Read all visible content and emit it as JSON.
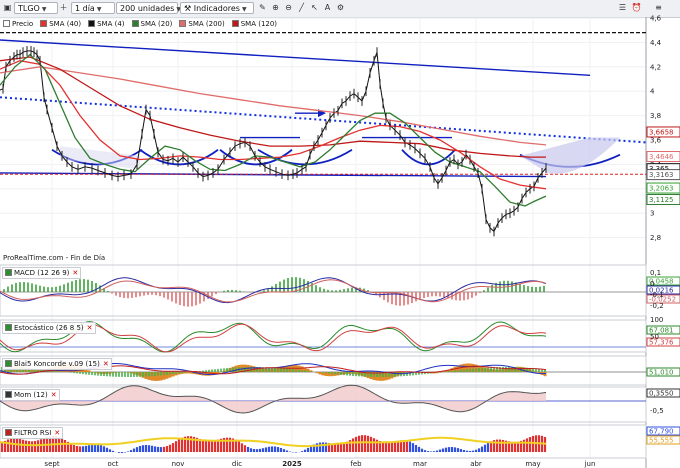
{
  "toolbar": {
    "symbol": "TLGO",
    "timeframe": "1 día",
    "units": "200 unidades",
    "indicators": "Indicadores"
  },
  "legend": [
    {
      "label": "Precio",
      "color": "#ffffff"
    },
    {
      "label": "SMA (40)",
      "color": "#e53030"
    },
    {
      "label": "SMA (4)",
      "color": "#111111"
    },
    {
      "label": "SMA (20)",
      "color": "#2f7d2f"
    },
    {
      "label": "SMA (200)",
      "color": "#e06c6c"
    },
    {
      "label": "SMA (120)",
      "color": "#c01818"
    }
  ],
  "credit": "ProRealTime.com - Fin de Día",
  "panels": {
    "macd": "MACD (12 26 9)",
    "stoch": "Estocástico (26 8 5)",
    "blai": "Blai5 Koncorde v.09 (15)",
    "mom": "Mom (12)",
    "rsi": "FILTRO RSI"
  },
  "months": [
    "sept",
    "oct",
    "nov",
    "dic",
    "2025",
    "feb",
    "mar",
    "abr",
    "may",
    "jun"
  ],
  "chart_data": {
    "type": "line",
    "title": "",
    "ylim": [
      2.6,
      4.6
    ],
    "yticks": [
      "4,6",
      "4,4",
      "4,2",
      "4",
      "3,8",
      "3,6",
      "3,4",
      "3,2",
      "3",
      "2,8"
    ],
    "price_tags": [
      {
        "value": 3.6658,
        "text": "3,6658",
        "color": "#c01818"
      },
      {
        "value": 3.4646,
        "text": "3,4646",
        "color": "#e06c6c"
      },
      {
        "value": 3.365,
        "text": "3,365",
        "color": "#111111"
      },
      {
        "value": 3.3163,
        "text": "3,3163",
        "color": "#555555"
      },
      {
        "value": 3.2063,
        "text": "3,2063",
        "color": "#2fa02f"
      },
      {
        "value": 3.1125,
        "text": "3,1125",
        "color": "#2f7d2f"
      }
    ],
    "series": [
      {
        "name": "Precio",
        "color": "#111111",
        "values": [
          [
            0,
            4.01
          ],
          [
            3,
            4.02
          ],
          [
            6,
            4.2
          ],
          [
            10,
            4.25
          ],
          [
            14,
            4.28
          ],
          [
            17,
            4.3
          ],
          [
            20,
            4.3
          ],
          [
            23,
            4.32
          ],
          [
            27,
            4.33
          ],
          [
            31,
            4.33
          ],
          [
            34,
            4.32
          ],
          [
            37,
            4.3
          ],
          [
            40,
            4.25
          ],
          [
            44,
            3.95
          ],
          [
            47,
            3.85
          ],
          [
            52,
            3.7
          ],
          [
            57,
            3.55
          ],
          [
            62,
            3.47
          ],
          [
            67,
            3.42
          ],
          [
            72,
            3.38
          ],
          [
            78,
            3.36
          ],
          [
            85,
            3.38
          ],
          [
            92,
            3.37
          ],
          [
            98,
            3.35
          ],
          [
            105,
            3.33
          ],
          [
            112,
            3.31
          ],
          [
            118,
            3.3
          ],
          [
            124,
            3.31
          ],
          [
            131,
            3.32
          ],
          [
            137,
            3.4
          ],
          [
            142,
            3.65
          ],
          [
            146,
            3.85
          ],
          [
            150,
            3.8
          ],
          [
            154,
            3.65
          ],
          [
            158,
            3.5
          ],
          [
            163,
            3.44
          ],
          [
            168,
            3.43
          ],
          [
            173,
            3.45
          ],
          [
            178,
            3.42
          ],
          [
            183,
            3.46
          ],
          [
            188,
            3.42
          ],
          [
            193,
            3.38
          ],
          [
            198,
            3.33
          ],
          [
            203,
            3.3
          ],
          [
            208,
            3.31
          ],
          [
            213,
            3.33
          ],
          [
            218,
            3.36
          ],
          [
            224,
            3.44
          ],
          [
            230,
            3.5
          ],
          [
            235,
            3.55
          ],
          [
            240,
            3.57
          ],
          [
            245,
            3.58
          ],
          [
            250,
            3.55
          ],
          [
            255,
            3.47
          ],
          [
            260,
            3.42
          ],
          [
            265,
            3.38
          ],
          [
            270,
            3.36
          ],
          [
            276,
            3.34
          ],
          [
            282,
            3.32
          ],
          [
            288,
            3.31
          ],
          [
            293,
            3.32
          ],
          [
            297,
            3.33
          ],
          [
            302,
            3.36
          ],
          [
            306,
            3.38
          ],
          [
            310,
            3.48
          ],
          [
            314,
            3.55
          ],
          [
            318,
            3.6
          ],
          [
            322,
            3.66
          ],
          [
            326,
            3.72
          ],
          [
            330,
            3.78
          ],
          [
            334,
            3.82
          ],
          [
            338,
            3.84
          ],
          [
            342,
            3.9
          ],
          [
            346,
            3.92
          ],
          [
            350,
            3.96
          ],
          [
            354,
            3.98
          ],
          [
            358,
            3.95
          ],
          [
            362,
            3.92
          ],
          [
            366,
            4.0
          ],
          [
            370,
            4.15
          ],
          [
            374,
            4.25
          ],
          [
            377,
            4.32
          ],
          [
            380,
            4.06
          ],
          [
            383,
            3.9
          ],
          [
            386,
            3.78
          ],
          [
            390,
            3.72
          ],
          [
            395,
            3.68
          ],
          [
            400,
            3.64
          ],
          [
            405,
            3.58
          ],
          [
            410,
            3.56
          ],
          [
            415,
            3.53
          ],
          [
            420,
            3.49
          ],
          [
            425,
            3.45
          ],
          [
            430,
            3.38
          ],
          [
            434,
            3.29
          ],
          [
            438,
            3.24
          ],
          [
            442,
            3.29
          ],
          [
            446,
            3.35
          ],
          [
            450,
            3.42
          ],
          [
            454,
            3.44
          ],
          [
            458,
            3.4
          ],
          [
            462,
            3.42
          ],
          [
            466,
            3.48
          ],
          [
            470,
            3.44
          ],
          [
            474,
            3.38
          ],
          [
            478,
            3.33
          ],
          [
            482,
            3.2
          ],
          [
            486,
            2.95
          ],
          [
            490,
            2.88
          ],
          [
            494,
            2.85
          ],
          [
            498,
            2.92
          ],
          [
            502,
            2.96
          ],
          [
            506,
            2.99
          ],
          [
            510,
            3.0
          ],
          [
            514,
            3.02
          ],
          [
            518,
            3.05
          ],
          [
            522,
            3.12
          ],
          [
            526,
            3.17
          ],
          [
            530,
            3.2
          ],
          [
            534,
            3.22
          ],
          [
            538,
            3.29
          ],
          [
            542,
            3.33
          ],
          [
            546,
            3.37
          ]
        ]
      },
      {
        "name": "SMA (200)",
        "color": "#e06c6c",
        "values": [
          [
            0,
            4.15
          ],
          [
            40,
            4.2
          ],
          [
            80,
            4.15
          ],
          [
            120,
            4.1
          ],
          [
            160,
            4.04
          ],
          [
            200,
            3.98
          ],
          [
            240,
            3.93
          ],
          [
            280,
            3.88
          ],
          [
            320,
            3.84
          ],
          [
            360,
            3.8
          ],
          [
            400,
            3.75
          ],
          [
            440,
            3.69
          ],
          [
            480,
            3.63
          ],
          [
            520,
            3.58
          ],
          [
            546,
            3.56
          ]
        ]
      },
      {
        "name": "SMA (120)",
        "color": "#c01818",
        "values": [
          [
            0,
            4.25
          ],
          [
            30,
            4.28
          ],
          [
            60,
            4.18
          ],
          [
            90,
            4.03
          ],
          [
            120,
            3.88
          ],
          [
            150,
            3.77
          ],
          [
            180,
            3.7
          ],
          [
            210,
            3.64
          ],
          [
            240,
            3.59
          ],
          [
            270,
            3.55
          ],
          [
            300,
            3.55
          ],
          [
            330,
            3.56
          ],
          [
            360,
            3.59
          ],
          [
            390,
            3.58
          ],
          [
            420,
            3.57
          ],
          [
            450,
            3.52
          ],
          [
            480,
            3.49
          ],
          [
            510,
            3.47
          ],
          [
            530,
            3.46
          ],
          [
            546,
            3.46
          ]
        ]
      },
      {
        "name": "SMA (40)",
        "color": "#e53030",
        "values": [
          [
            0,
            4.18
          ],
          [
            20,
            4.25
          ],
          [
            40,
            4.22
          ],
          [
            60,
            4.05
          ],
          [
            80,
            3.8
          ],
          [
            100,
            3.6
          ],
          [
            120,
            3.47
          ],
          [
            140,
            3.44
          ],
          [
            160,
            3.45
          ],
          [
            180,
            3.47
          ],
          [
            200,
            3.46
          ],
          [
            220,
            3.44
          ],
          [
            240,
            3.44
          ],
          [
            260,
            3.45
          ],
          [
            280,
            3.46
          ],
          [
            300,
            3.49
          ],
          [
            320,
            3.55
          ],
          [
            340,
            3.62
          ],
          [
            360,
            3.68
          ],
          [
            380,
            3.72
          ],
          [
            400,
            3.71
          ],
          [
            420,
            3.67
          ],
          [
            440,
            3.6
          ],
          [
            460,
            3.5
          ],
          [
            480,
            3.38
          ],
          [
            500,
            3.28
          ],
          [
            520,
            3.23
          ],
          [
            546,
            3.2
          ]
        ]
      },
      {
        "name": "SMA (20)",
        "color": "#2f7d2f",
        "values": [
          [
            0,
            4.05
          ],
          [
            15,
            4.2
          ],
          [
            30,
            4.3
          ],
          [
            45,
            4.18
          ],
          [
            60,
            3.9
          ],
          [
            75,
            3.62
          ],
          [
            90,
            3.45
          ],
          [
            105,
            3.4
          ],
          [
            120,
            3.36
          ],
          [
            135,
            3.34
          ],
          [
            150,
            3.45
          ],
          [
            165,
            3.55
          ],
          [
            180,
            3.52
          ],
          [
            195,
            3.43
          ],
          [
            210,
            3.36
          ],
          [
            225,
            3.35
          ],
          [
            240,
            3.4
          ],
          [
            255,
            3.47
          ],
          [
            270,
            3.46
          ],
          [
            285,
            3.42
          ],
          [
            300,
            3.38
          ],
          [
            315,
            3.42
          ],
          [
            330,
            3.52
          ],
          [
            345,
            3.64
          ],
          [
            360,
            3.76
          ],
          [
            375,
            3.82
          ],
          [
            390,
            3.82
          ],
          [
            405,
            3.74
          ],
          [
            420,
            3.62
          ],
          [
            435,
            3.5
          ],
          [
            450,
            3.42
          ],
          [
            465,
            3.38
          ],
          [
            480,
            3.34
          ],
          [
            495,
            3.22
          ],
          [
            510,
            3.09
          ],
          [
            525,
            3.06
          ],
          [
            535,
            3.1
          ],
          [
            546,
            3.14
          ]
        ]
      }
    ],
    "annotations": [
      {
        "type": "channel-top",
        "color": "#1020c0",
        "from": [
          0,
          4.42
        ],
        "to": [
          590,
          4.13
        ]
      },
      {
        "type": "dotted-trend",
        "color": "#1030e0",
        "from": [
          0,
          3.95
        ],
        "to": [
          646,
          3.58
        ]
      },
      {
        "type": "support",
        "color": "#1020c0",
        "from": [
          0,
          3.33
        ],
        "to": [
          546,
          3.3
        ]
      },
      {
        "type": "red-dashed",
        "color": "#e02020",
        "from": [
          0,
          3.32
        ],
        "to": [
          680,
          3.32
        ]
      },
      {
        "type": "black-dashed",
        "color": "#111111",
        "from": [
          0,
          4.48
        ],
        "to": [
          646,
          4.48
        ]
      }
    ],
    "xticks": [
      52,
      113,
      178,
      237,
      292,
      356,
      420,
      476,
      533,
      590
    ]
  },
  "indicator_tags": {
    "macd": [
      "0,0458",
      "0,0216",
      "-0,0252"
    ],
    "macd_axis": [
      "0,1",
      "0",
      "-0,1",
      "-0,2"
    ],
    "stoch": [
      "67,081",
      "57,376"
    ],
    "stoch_axis": [
      "100",
      "50"
    ],
    "blai": [
      "51,010"
    ],
    "mom": [
      "0,3550"
    ],
    "mom_axis": [
      "-0,5"
    ],
    "rsi": [
      "67,790",
      "55,555"
    ]
  }
}
